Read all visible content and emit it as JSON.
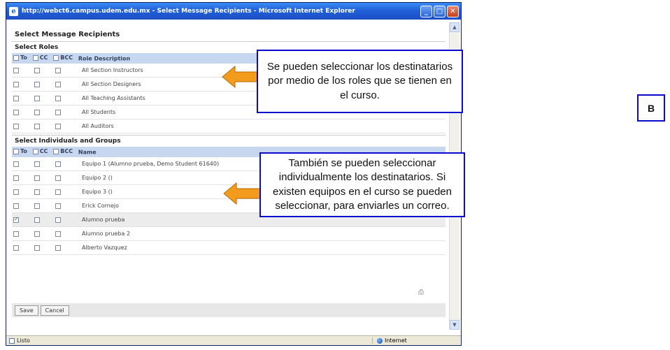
{
  "window": {
    "title": "http://webct6.campus.udem.edu.mx - Select Message Recipients - Microsoft Internet Explorer",
    "status": "Listo",
    "zone": "Internet"
  },
  "page": {
    "heading": "Select Message Recipients",
    "roles_section": "Select Roles",
    "individuals_section": "Select Individuals and Groups",
    "header_to": "To",
    "header_cc": "CC",
    "header_bcc": "BCC",
    "role_col": "Role Description",
    "name_col": "Name",
    "roles": [
      "All Section Instructors",
      "All Section Designers",
      "All Teaching Assistants",
      "All Students",
      "All Auditors"
    ],
    "individuals": [
      {
        "name": "Equipo 1 (Alumno prueba, Demo Student 61640)",
        "to": false
      },
      {
        "name": "Equipo 2 ()",
        "to": false
      },
      {
        "name": "Equipo 3 ()",
        "to": false
      },
      {
        "name": "Erick Cornejo",
        "to": false
      },
      {
        "name": "Alumno prueba",
        "to": true
      },
      {
        "name": "Alumno prueba 2",
        "to": false
      },
      {
        "name": "Alberto Vazquez",
        "to": false
      }
    ],
    "save": "Save",
    "cancel": "Cancel"
  },
  "callouts": {
    "roles": "Se pueden seleccionar los destinatarios por medio de los roles que se tienen en el curso.",
    "individuals": "También se pueden seleccionar individualmente los destinatarios. Si existen equipos en el curso se pueden seleccionar, para enviarles un correo.",
    "badge": "B",
    "border_color": "#0b0bd0",
    "arrow_color": "#f29b1d"
  }
}
